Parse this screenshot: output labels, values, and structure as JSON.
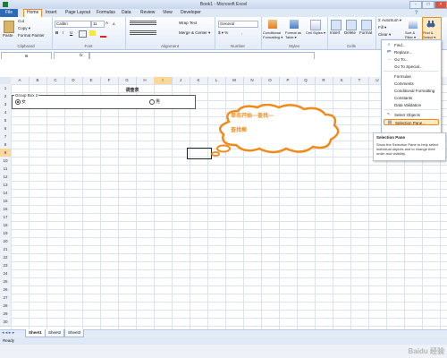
{
  "window": {
    "title": "Book1 - Microsoft Excel",
    "buttons": [
      "-",
      "□",
      "×"
    ]
  },
  "tabs": [
    "File",
    "Home",
    "Insert",
    "Page Layout",
    "Formulas",
    "Data",
    "Review",
    "View",
    "Developer"
  ],
  "ribbon": {
    "clipboard": {
      "paste": "Paste",
      "cut": "Cut",
      "copy": "Copy ▾",
      "format_painter": "Format Painter",
      "label": "Clipboard"
    },
    "font": {
      "name": "Calibri",
      "size": "11",
      "label": "Font",
      "bold": "B",
      "italic": "I",
      "underline": "U",
      "grow": "A",
      "shrink": "A"
    },
    "alignment": {
      "wrap": "Wrap Text",
      "merge": "Merge & Center ▾",
      "label": "Alignment"
    },
    "number": {
      "format": "General",
      "currency": "$ ▾ %",
      "comma": ",",
      "label": "Number"
    },
    "styles": {
      "conditional": "Conditional Formatting ▾",
      "table": "Format as Table ▾",
      "cell": "Cell Styles ▾",
      "label": "Styles"
    },
    "cells": {
      "insert": "Insert",
      "delete": "Delete",
      "format": "Format",
      "label": "Cells"
    },
    "editing": {
      "autosum": "Σ AutoSum ▾",
      "fill": "Fill ▾",
      "clear": "Clear ▾",
      "sort": "Sort & Filter ▾",
      "find": "Find & Select ▾"
    }
  },
  "formula_bar": {
    "namebox": "I6",
    "fx": "fx"
  },
  "columns": [
    "A",
    "B",
    "C",
    "D",
    "E",
    "F",
    "G",
    "H",
    "I",
    "J",
    "K",
    "L",
    "M",
    "N",
    "O",
    "P",
    "Q",
    "R",
    "S",
    "T",
    "U",
    "V",
    "W",
    "X"
  ],
  "rows": [
    "1",
    "2",
    "3",
    "4",
    "5",
    "6",
    "7",
    "8",
    "9",
    "10",
    "11",
    "12",
    "13",
    "14",
    "15",
    "16",
    "17",
    "18",
    "19",
    "20",
    "21",
    "22",
    "23",
    "24",
    "25",
    "26",
    "27",
    "28",
    "29",
    "30"
  ],
  "sheet": {
    "title": "调查表",
    "groupbox_label": "Group Box 2",
    "radio_female": "女",
    "radio_male": "男"
  },
  "menu": {
    "items": [
      "Find...",
      "Replace...",
      "Go To...",
      "Go To Special...",
      "Formulas",
      "Comments",
      "Conditional Formatting",
      "Constants",
      "Data Validation",
      "Select Objects",
      "Selection Pane..."
    ],
    "icons": [
      "binoculars-icon",
      "replace-icon",
      "goto-icon",
      "",
      "",
      "",
      "",
      "",
      "",
      "pointer-icon",
      "selection-pane-icon"
    ]
  },
  "tooltip": {
    "title": "Selection Pane",
    "body": "Show the Selection Pane to help select individual objects and to change their order and visibility."
  },
  "callout": {
    "line1": "单击开始---查找---",
    "line2": "查找框"
  },
  "sheet_tabs": [
    "Sheet1",
    "Sheet2",
    "Sheet3"
  ],
  "status": {
    "ready": "Ready"
  },
  "watermark": "Baidu 经验",
  "colors": {
    "accent": "#f08a1a",
    "file_tab": "#2d6ab7",
    "callout_fill": "#ffffff"
  }
}
